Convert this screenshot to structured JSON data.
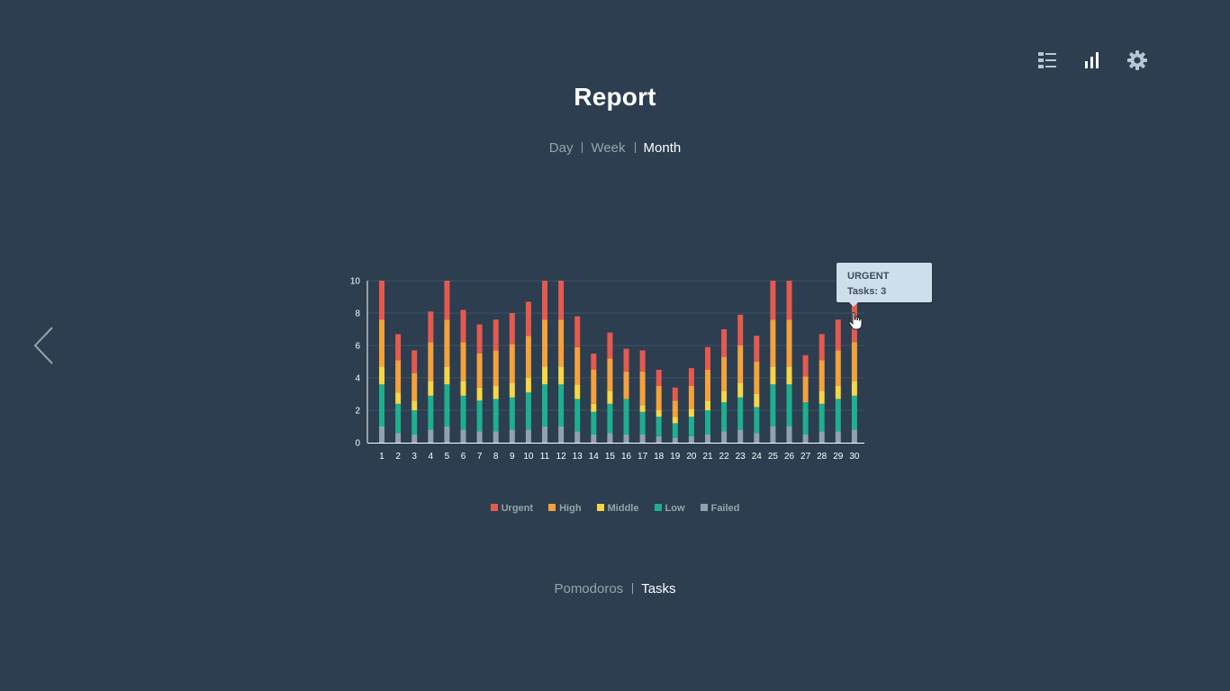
{
  "toolbar": {
    "icons": [
      "list-icon",
      "bar-chart-icon",
      "gear-icon"
    ]
  },
  "header": {
    "title": "Report"
  },
  "period_tabs": [
    {
      "label": "Day",
      "active": false
    },
    {
      "label": "Week",
      "active": false
    },
    {
      "label": "Month",
      "active": true
    }
  ],
  "metric_tabs": [
    {
      "label": "Pomodoros",
      "active": false
    },
    {
      "label": "Tasks",
      "active": true
    }
  ],
  "tooltip": {
    "title": "URGENT",
    "text": "Tasks: 3"
  },
  "legend": [
    {
      "label": "Urgent",
      "color": "#e55a4e"
    },
    {
      "label": "High",
      "color": "#f5a13c"
    },
    {
      "label": "Middle",
      "color": "#f7d646"
    },
    {
      "label": "Low",
      "color": "#1eaf8f"
    },
    {
      "label": "Failed",
      "color": "#8fa2b4"
    }
  ],
  "colors": {
    "background": "#2c3e50",
    "text_muted": "#95a5a6",
    "grid": "#3e5366"
  },
  "chart_data": {
    "type": "bar",
    "stacked": true,
    "categories": [
      "1",
      "2",
      "3",
      "4",
      "5",
      "6",
      "7",
      "8",
      "9",
      "10",
      "11",
      "12",
      "13",
      "14",
      "15",
      "16",
      "17",
      "18",
      "19",
      "20",
      "21",
      "22",
      "23",
      "24",
      "25",
      "26",
      "27",
      "28",
      "29",
      "30"
    ],
    "series": [
      {
        "name": "Failed",
        "color": "#8fa2b4",
        "values": [
          1,
          0.6,
          0.5,
          0.8,
          1,
          0.8,
          0.7,
          0.7,
          0.8,
          0.8,
          1,
          1,
          0.7,
          0.5,
          0.6,
          0.5,
          0.5,
          0.4,
          0.3,
          0.4,
          0.5,
          0.7,
          0.8,
          0.6,
          1,
          1,
          0.5,
          0.7,
          0.7,
          0.8
        ]
      },
      {
        "name": "Low",
        "color": "#1eaf8f",
        "values": [
          2.6,
          1.8,
          1.5,
          2.1,
          2.6,
          2.1,
          1.9,
          2,
          2,
          2.3,
          2.6,
          2.6,
          2,
          1.4,
          1.8,
          2.2,
          1.4,
          1.2,
          0.9,
          1.2,
          1.5,
          1.8,
          2,
          1.6,
          2.6,
          2.6,
          2,
          1.7,
          2,
          2.1
        ]
      },
      {
        "name": "Middle",
        "color": "#f7d646",
        "values": [
          1.1,
          0.7,
          0.6,
          0.9,
          1.1,
          0.9,
          0.8,
          0.8,
          0.9,
          0.9,
          1.1,
          1.1,
          0.9,
          0.5,
          0.8,
          0,
          0.4,
          0.4,
          0.4,
          0.5,
          0.6,
          0.7,
          0.9,
          0.8,
          1.1,
          1.1,
          0,
          0.8,
          0.8,
          0.9
        ]
      },
      {
        "name": "High",
        "color": "#f5a13c",
        "values": [
          2.9,
          2,
          1.7,
          2.4,
          2.9,
          2.4,
          2.1,
          2.2,
          2.4,
          2.6,
          2.9,
          2.9,
          2.3,
          2.1,
          2,
          1.7,
          2.1,
          1.5,
          1,
          1.4,
          1.9,
          2.1,
          2.3,
          2,
          2.9,
          2.9,
          1.6,
          1.9,
          2.2,
          2.4
        ]
      },
      {
        "name": "Urgent",
        "color": "#e55a4e",
        "values": [
          2.4,
          1.6,
          1.4,
          1.9,
          2.4,
          2,
          1.8,
          1.9,
          1.9,
          2.1,
          2.4,
          2.4,
          1.9,
          1,
          1.6,
          1.4,
          1.3,
          1,
          0.8,
          1.1,
          1.4,
          1.7,
          1.9,
          1.6,
          2.4,
          2.4,
          1.3,
          1.6,
          1.9,
          3
        ]
      }
    ],
    "ylim": [
      0,
      10
    ],
    "yticks": [
      "0",
      "2",
      "4",
      "6",
      "8",
      "10"
    ],
    "grid": true,
    "legend_position": "bottom"
  }
}
